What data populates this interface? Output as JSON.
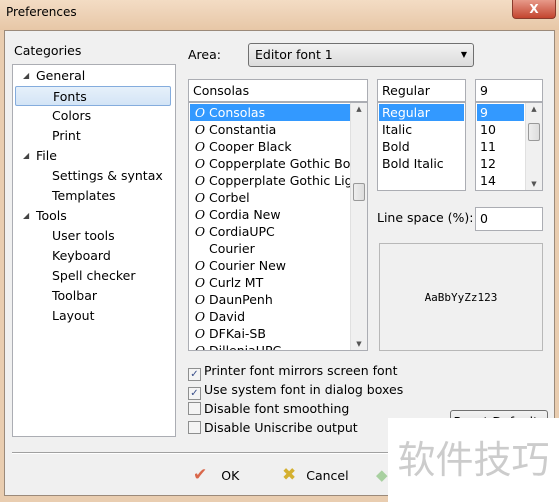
{
  "window": {
    "title": "Preferences",
    "close_label": "X"
  },
  "categories": {
    "label": "Categories",
    "items": [
      {
        "label": "General",
        "level": 0,
        "expanded": true
      },
      {
        "label": "Fonts",
        "level": 1,
        "selected": true
      },
      {
        "label": "Colors",
        "level": 1
      },
      {
        "label": "Print",
        "level": 1
      },
      {
        "label": "File",
        "level": 0,
        "expanded": true
      },
      {
        "label": "Settings & syntax",
        "level": 1
      },
      {
        "label": "Templates",
        "level": 1
      },
      {
        "label": "Tools",
        "level": 0,
        "expanded": true
      },
      {
        "label": "User tools",
        "level": 1
      },
      {
        "label": "Keyboard",
        "level": 1
      },
      {
        "label": "Spell checker",
        "level": 1
      },
      {
        "label": "Toolbar",
        "level": 1
      },
      {
        "label": "Layout",
        "level": 1
      }
    ]
  },
  "area": {
    "label": "Area:",
    "value": "Editor font 1"
  },
  "font": {
    "value": "Consolas",
    "items": [
      "Consolas",
      "Constantia",
      "Cooper Black",
      "Copperplate Gothic Bold",
      "Copperplate Gothic Light",
      "Corbel",
      "Cordia New",
      "CordiaUPC",
      "Courier",
      "Courier New",
      "Curlz MT",
      "DaunPenh",
      "David",
      "DFKai-SB",
      "DilleniaUPC"
    ],
    "no_icon": [
      "Courier"
    ]
  },
  "style": {
    "value": "Regular",
    "items": [
      "Regular",
      "Italic",
      "Bold",
      "Bold Italic"
    ]
  },
  "size": {
    "value": "9",
    "items": [
      "9",
      "10",
      "11",
      "12",
      "14"
    ]
  },
  "line_space": {
    "label": "Line space (%):",
    "value": "0"
  },
  "preview": {
    "text": "AaBbYyZz123"
  },
  "options": [
    {
      "label": "Printer font mirrors screen font",
      "checked": true
    },
    {
      "label": "Use system font in dialog boxes",
      "checked": true
    },
    {
      "label": "Disable font smoothing",
      "checked": false
    },
    {
      "label": "Disable Uniscribe output",
      "checked": false
    }
  ],
  "reset_button": "Reset Defaults",
  "buttons": {
    "ok": "OK",
    "cancel": "Cancel"
  },
  "watermark": "软件技巧"
}
